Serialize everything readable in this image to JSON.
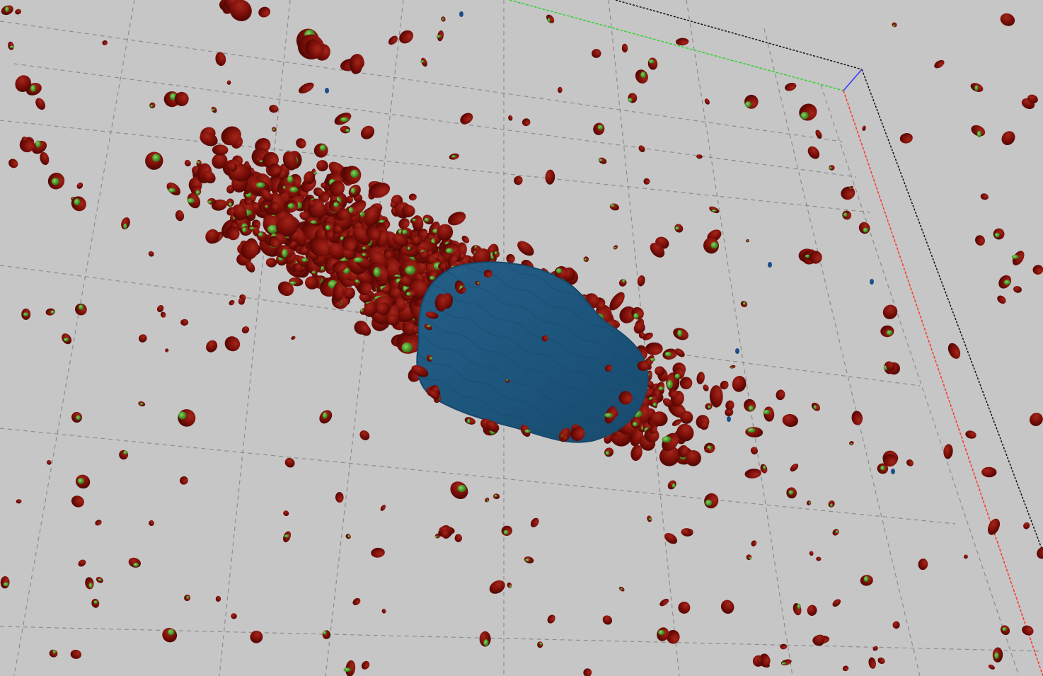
{
  "viewport": {
    "background": "#c6c6c6",
    "grid_color": "#7a7a7a",
    "axes": {
      "x_color": "#ff3b30",
      "y_color": "#39d239",
      "z_color": "#3a3aff",
      "box_color": "#111111"
    }
  },
  "render": {
    "nucleus_color": "#1f5c86",
    "nucleus_edge_color": "#16486b",
    "puncta_color": "#7a0e08",
    "puncta_highlight_color": "#4c9a2a",
    "small_marker_color": "#1b4f88"
  }
}
